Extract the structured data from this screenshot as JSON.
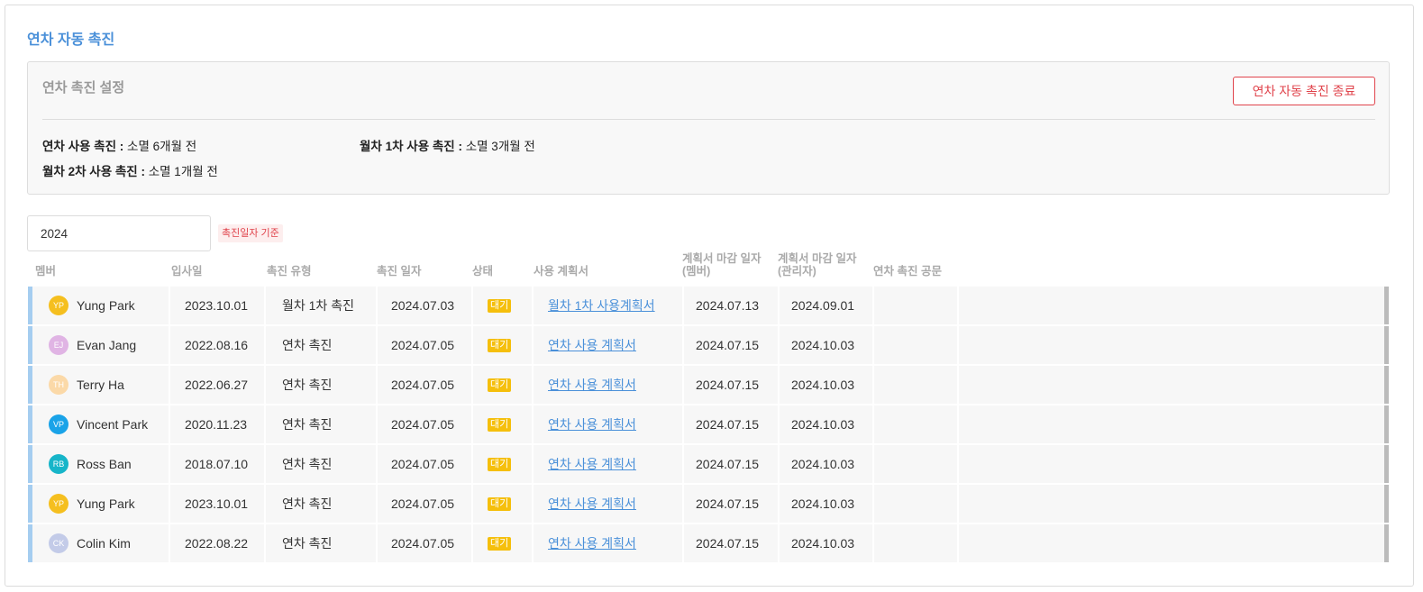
{
  "page": {
    "title": "연차 자동 촉진"
  },
  "settings": {
    "title": "연차 촉진 설정",
    "stop_button": "연차 자동 촉진 종료",
    "items": [
      {
        "label": "연차 사용 촉진 :",
        "value": "소멸 6개월 전"
      },
      {
        "label": "월차 1차 사용 촉진 :",
        "value": "소멸 3개월 전"
      },
      {
        "label": "월차 2차 사용 촉진 :",
        "value": "소멸 1개월 전"
      }
    ]
  },
  "filter": {
    "year": "2024",
    "basis": "촉진일자 기준"
  },
  "table": {
    "headers": {
      "member": "멤버",
      "join": "입사일",
      "type": "촉진 유형",
      "date": "촉진 일자",
      "status": "상태",
      "plan": "사용 계획서",
      "due_member_1": "계획서 마감 일자",
      "due_member_2": "(멤버)",
      "due_admin_1": "계획서 마감 일자",
      "due_admin_2": "(관리자)",
      "notice": "연차 촉진 공문"
    },
    "rows": [
      {
        "initials": "YP",
        "avatar_color": "#f5bf1f",
        "name": "Yung Park",
        "join": "2023.10.01",
        "type": "월차 1차 촉진",
        "date": "2024.07.03",
        "status": "대기",
        "plan": "월차 1차 사용계획서",
        "due_member": "2024.07.13",
        "due_admin": "2024.09.01"
      },
      {
        "initials": "EJ",
        "avatar_color": "#e0b4e4",
        "name": "Evan Jang",
        "join": "2022.08.16",
        "type": "연차 촉진",
        "date": "2024.07.05",
        "status": "대기",
        "plan": "연차 사용 계획서",
        "due_member": "2024.07.15",
        "due_admin": "2024.10.03"
      },
      {
        "initials": "TH",
        "avatar_color": "#fbd9a8",
        "name": "Terry Ha",
        "join": "2022.06.27",
        "type": "연차 촉진",
        "date": "2024.07.05",
        "status": "대기",
        "plan": "연차 사용 계획서",
        "due_member": "2024.07.15",
        "due_admin": "2024.10.03"
      },
      {
        "initials": "VP",
        "avatar_color": "#1aa3e8",
        "name": "Vincent Park",
        "join": "2020.11.23",
        "type": "연차 촉진",
        "date": "2024.07.05",
        "status": "대기",
        "plan": "연차 사용 계획서",
        "due_member": "2024.07.15",
        "due_admin": "2024.10.03"
      },
      {
        "initials": "RB",
        "avatar_color": "#17b5c9",
        "name": "Ross Ban",
        "join": "2018.07.10",
        "type": "연차 촉진",
        "date": "2024.07.05",
        "status": "대기",
        "plan": "연차 사용 계획서",
        "due_member": "2024.07.15",
        "due_admin": "2024.10.03"
      },
      {
        "initials": "YP",
        "avatar_color": "#f5bf1f",
        "name": "Yung Park",
        "join": "2023.10.01",
        "type": "연차 촉진",
        "date": "2024.07.05",
        "status": "대기",
        "plan": "연차 사용 계획서",
        "due_member": "2024.07.15",
        "due_admin": "2024.10.03"
      },
      {
        "initials": "CK",
        "avatar_color": "#c3cbe8",
        "name": "Colin Kim",
        "join": "2022.08.22",
        "type": "연차 촉진",
        "date": "2024.07.05",
        "status": "대기",
        "plan": "연차 사용 계획서",
        "due_member": "2024.07.15",
        "due_admin": "2024.10.03"
      }
    ]
  }
}
